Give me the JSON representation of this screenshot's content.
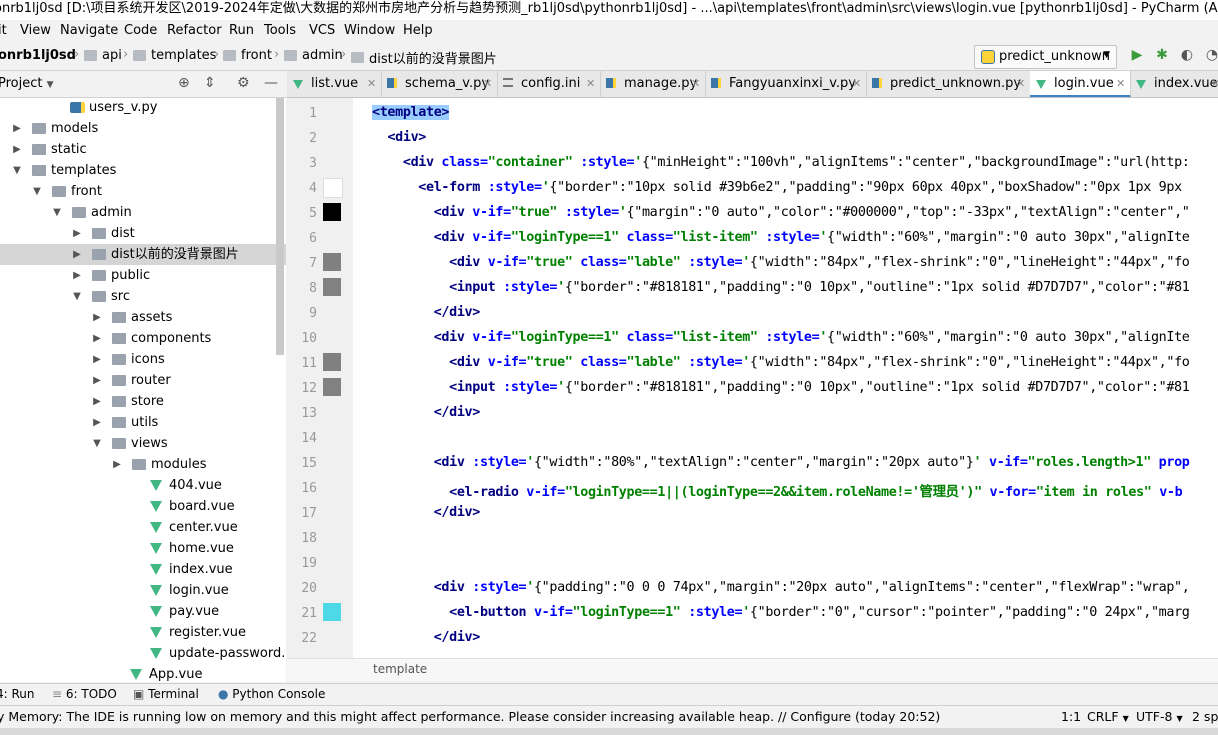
{
  "window": {
    "title": "onrb1lj0sd [D:\\项目系统开发区\\2019-2024年定做\\大数据的郑州市房地产分析与趋势预测_rb1lj0sd\\pythonrb1lj0sd] - ...\\api\\templates\\front\\admin\\src\\views\\login.vue [pythonrb1lj0sd] - PyCharm (Administrat..."
  },
  "menu": [
    "it",
    "View",
    "Navigate",
    "Code",
    "Refactor",
    "Run",
    "Tools",
    "VCS",
    "Window",
    "Help"
  ],
  "breadcrumb": [
    "onrb1lj0sd",
    "api",
    "templates",
    "front",
    "admin",
    "dist以前的没背景图片"
  ],
  "run_config": {
    "label": "predict_unknown"
  },
  "project": {
    "header": "Project",
    "items": [
      {
        "label": "users_v.py",
        "type": "py"
      },
      {
        "label": "models",
        "type": "folder",
        "arrow": "right"
      },
      {
        "label": "static",
        "type": "folder",
        "arrow": "right"
      },
      {
        "label": "templates",
        "type": "folder",
        "arrow": "down"
      },
      {
        "label": "front",
        "type": "folder",
        "arrow": "down"
      },
      {
        "label": "admin",
        "type": "folder",
        "arrow": "down"
      },
      {
        "label": "dist",
        "type": "folder",
        "arrow": "right"
      },
      {
        "label": "dist以前的没背景图片",
        "type": "folder",
        "arrow": "right",
        "selected": true
      },
      {
        "label": "public",
        "type": "folder",
        "arrow": "right"
      },
      {
        "label": "src",
        "type": "folder",
        "arrow": "down"
      },
      {
        "label": "assets",
        "type": "folder",
        "arrow": "right"
      },
      {
        "label": "components",
        "type": "folder",
        "arrow": "right"
      },
      {
        "label": "icons",
        "type": "folder",
        "arrow": "right"
      },
      {
        "label": "router",
        "type": "folder",
        "arrow": "right"
      },
      {
        "label": "store",
        "type": "folder",
        "arrow": "right"
      },
      {
        "label": "utils",
        "type": "folder",
        "arrow": "right"
      },
      {
        "label": "views",
        "type": "folder",
        "arrow": "down"
      },
      {
        "label": "modules",
        "type": "folder",
        "arrow": "right"
      },
      {
        "label": "404.vue",
        "type": "vue"
      },
      {
        "label": "board.vue",
        "type": "vue"
      },
      {
        "label": "center.vue",
        "type": "vue"
      },
      {
        "label": "home.vue",
        "type": "vue"
      },
      {
        "label": "index.vue",
        "type": "vue"
      },
      {
        "label": "login.vue",
        "type": "vue"
      },
      {
        "label": "pay.vue",
        "type": "vue"
      },
      {
        "label": "register.vue",
        "type": "vue"
      },
      {
        "label": "update-password.vue",
        "type": "vue"
      },
      {
        "label": "App.vue",
        "type": "vue"
      }
    ]
  },
  "tabs": [
    {
      "label": "list.vue",
      "type": "vue"
    },
    {
      "label": "schema_v.py",
      "type": "py"
    },
    {
      "label": "config.ini",
      "type": "ini"
    },
    {
      "label": "manage.py",
      "type": "py"
    },
    {
      "label": "Fangyuanxinxi_v.py",
      "type": "py"
    },
    {
      "label": "predict_unknown.py",
      "type": "py"
    },
    {
      "label": "login.vue",
      "type": "vue",
      "active": true
    },
    {
      "label": "index.vue",
      "type": "vue"
    }
  ],
  "editor": {
    "line_numbers": [
      "1",
      "2",
      "3",
      "4",
      "5",
      "6",
      "7",
      "8",
      "9",
      "10",
      "11",
      "12",
      "13",
      "14",
      "15",
      "16",
      "17",
      "18",
      "19",
      "20",
      "21",
      "22"
    ],
    "gutter_swatches": [
      "",
      "",
      "",
      "#ffffff",
      "#000000",
      "",
      "#808080",
      "#818181",
      "",
      "",
      "#808080",
      "#818181",
      "",
      "",
      "",
      "",
      "",
      "",
      "",
      "",
      "#4dd9e8",
      ""
    ],
    "lines": [
      [
        {
          "c": "tag",
          "t": "<template>"
        }
      ],
      [
        {
          "c": "nrm",
          "t": "  "
        },
        {
          "c": "tag",
          "t": "<div>"
        }
      ],
      [
        {
          "c": "nrm",
          "t": "    "
        },
        {
          "c": "tag",
          "t": "<div "
        },
        {
          "c": "att",
          "t": "class="
        },
        {
          "c": "str",
          "t": "\"container\""
        },
        {
          "c": "att",
          "t": " :style="
        },
        {
          "c": "str",
          "t": "'"
        },
        {
          "c": "nrm",
          "t": "{\"minHeight\":\"100vh\",\"alignItems\":\"center\",\"backgroundImage\":\"url(http:"
        }
      ],
      [
        {
          "c": "nrm",
          "t": "      "
        },
        {
          "c": "tag",
          "t": "<el-form "
        },
        {
          "c": "att",
          "t": ":style="
        },
        {
          "c": "str",
          "t": "'"
        },
        {
          "c": "nrm",
          "t": "{\"border\":\"10px solid #39b6e2\",\"padding\":\"90px 60px 40px\",\"boxShadow\":\"0px 1px 9px"
        }
      ],
      [
        {
          "c": "nrm",
          "t": "        "
        },
        {
          "c": "tag",
          "t": "<div "
        },
        {
          "c": "att",
          "t": "v-if="
        },
        {
          "c": "str",
          "t": "\"true\""
        },
        {
          "c": "att",
          "t": " :style="
        },
        {
          "c": "str",
          "t": "'"
        },
        {
          "c": "nrm",
          "t": "{\"margin\":\"0 auto\",\"color\":\"#000000\",\"top\":\"-33px\",\"textAlign\":\"center\",\""
        }
      ],
      [
        {
          "c": "nrm",
          "t": "        "
        },
        {
          "c": "tag",
          "t": "<div "
        },
        {
          "c": "att",
          "t": "v-if="
        },
        {
          "c": "str",
          "t": "\"loginType==1\""
        },
        {
          "c": "att",
          "t": " class="
        },
        {
          "c": "str",
          "t": "\"list-item\""
        },
        {
          "c": "att",
          "t": " :style="
        },
        {
          "c": "str",
          "t": "'"
        },
        {
          "c": "nrm",
          "t": "{\"width\":\"60%\",\"margin\":\"0 auto 30px\",\"alignIte"
        }
      ],
      [
        {
          "c": "nrm",
          "t": "          "
        },
        {
          "c": "tag",
          "t": "<div "
        },
        {
          "c": "att",
          "t": "v-if="
        },
        {
          "c": "str",
          "t": "\"true\""
        },
        {
          "c": "att",
          "t": " class="
        },
        {
          "c": "str",
          "t": "\"lable\""
        },
        {
          "c": "att",
          "t": " :style="
        },
        {
          "c": "str",
          "t": "'"
        },
        {
          "c": "nrm",
          "t": "{\"width\":\"84px\",\"flex-shrink\":\"0\",\"lineHeight\":\"44px\",\"fo"
        }
      ],
      [
        {
          "c": "nrm",
          "t": "          "
        },
        {
          "c": "tag",
          "t": "<input "
        },
        {
          "c": "att",
          "t": ":style="
        },
        {
          "c": "str",
          "t": "'"
        },
        {
          "c": "nrm",
          "t": "{\"border\":\"#818181\",\"padding\":\"0 10px\",\"outline\":\"1px solid #D7D7D7\",\"color\":\"#81"
        }
      ],
      [
        {
          "c": "nrm",
          "t": "        "
        },
        {
          "c": "tag",
          "t": "</div>"
        }
      ],
      [
        {
          "c": "nrm",
          "t": "        "
        },
        {
          "c": "tag",
          "t": "<div "
        },
        {
          "c": "att",
          "t": "v-if="
        },
        {
          "c": "str",
          "t": "\"loginType==1\""
        },
        {
          "c": "att",
          "t": " class="
        },
        {
          "c": "str",
          "t": "\"list-item\""
        },
        {
          "c": "att",
          "t": " :style="
        },
        {
          "c": "str",
          "t": "'"
        },
        {
          "c": "nrm",
          "t": "{\"width\":\"60%\",\"margin\":\"0 auto 30px\",\"alignIte"
        }
      ],
      [
        {
          "c": "nrm",
          "t": "          "
        },
        {
          "c": "tag",
          "t": "<div "
        },
        {
          "c": "att",
          "t": "v-if="
        },
        {
          "c": "str",
          "t": "\"true\""
        },
        {
          "c": "att",
          "t": " class="
        },
        {
          "c": "str",
          "t": "\"lable\""
        },
        {
          "c": "att",
          "t": " :style="
        },
        {
          "c": "str",
          "t": "'"
        },
        {
          "c": "nrm",
          "t": "{\"width\":\"84px\",\"flex-shrink\":\"0\",\"lineHeight\":\"44px\",\"fo"
        }
      ],
      [
        {
          "c": "nrm",
          "t": "          "
        },
        {
          "c": "tag",
          "t": "<input "
        },
        {
          "c": "att",
          "t": ":style="
        },
        {
          "c": "str",
          "t": "'"
        },
        {
          "c": "nrm",
          "t": "{\"border\":\"#818181\",\"padding\":\"0 10px\",\"outline\":\"1px solid #D7D7D7\",\"color\":\"#81"
        }
      ],
      [
        {
          "c": "nrm",
          "t": "        "
        },
        {
          "c": "tag",
          "t": "</div>"
        }
      ],
      [],
      [
        {
          "c": "nrm",
          "t": "        "
        },
        {
          "c": "tag",
          "t": "<div "
        },
        {
          "c": "att",
          "t": ":style="
        },
        {
          "c": "str",
          "t": "'"
        },
        {
          "c": "nrm",
          "t": "{\"width\":\"80%\",\"textAlign\":\"center\",\"margin\":\"20px auto\"}"
        },
        {
          "c": "str",
          "t": "'"
        },
        {
          "c": "att",
          "t": " v-if="
        },
        {
          "c": "str",
          "t": "\"roles.length>1\""
        },
        {
          "c": "att",
          "t": " prop"
        }
      ],
      [
        {
          "c": "nrm",
          "t": "          "
        },
        {
          "c": "tag",
          "t": "<el-radio "
        },
        {
          "c": "att",
          "t": "v-if="
        },
        {
          "c": "str",
          "t": "\"loginType==1||(loginType==2&&item.roleName!='管理员')\""
        },
        {
          "c": "att",
          "t": " v-for="
        },
        {
          "c": "str",
          "t": "\"item in roles\""
        },
        {
          "c": "att",
          "t": " v-b"
        }
      ],
      [
        {
          "c": "nrm",
          "t": "        "
        },
        {
          "c": "tag",
          "t": "</div>"
        }
      ],
      [],
      [],
      [
        {
          "c": "nrm",
          "t": "        "
        },
        {
          "c": "tag",
          "t": "<div "
        },
        {
          "c": "att",
          "t": ":style="
        },
        {
          "c": "str",
          "t": "'"
        },
        {
          "c": "nrm",
          "t": "{\"padding\":\"0 0 0 74px\",\"margin\":\"20px auto\",\"alignItems\":\"center\",\"flexWrap\":\"wrap\","
        }
      ],
      [
        {
          "c": "nrm",
          "t": "          "
        },
        {
          "c": "tag",
          "t": "<el-button "
        },
        {
          "c": "att",
          "t": "v-if="
        },
        {
          "c": "str",
          "t": "\"loginType==1\""
        },
        {
          "c": "att",
          "t": " :style="
        },
        {
          "c": "str",
          "t": "'"
        },
        {
          "c": "nrm",
          "t": "{\"border\":\"0\",\"cursor\":\"pointer\",\"padding\":\"0 24px\",\"marg"
        }
      ],
      [
        {
          "c": "nrm",
          "t": "        "
        },
        {
          "c": "tag",
          "t": "</div>"
        }
      ]
    ]
  },
  "editor_breadcrumb": "template",
  "tool_windows": [
    "4: Run",
    "6: TODO",
    "Terminal",
    "Python Console"
  ],
  "status": {
    "message": "y Memory: The IDE is running low on memory and this might affect performance. Please consider increasing available heap. // Configure (today 20:52)",
    "position": "1:1",
    "line_sep": "CRLF",
    "encoding": "UTF-8",
    "indent": "2 sp"
  }
}
